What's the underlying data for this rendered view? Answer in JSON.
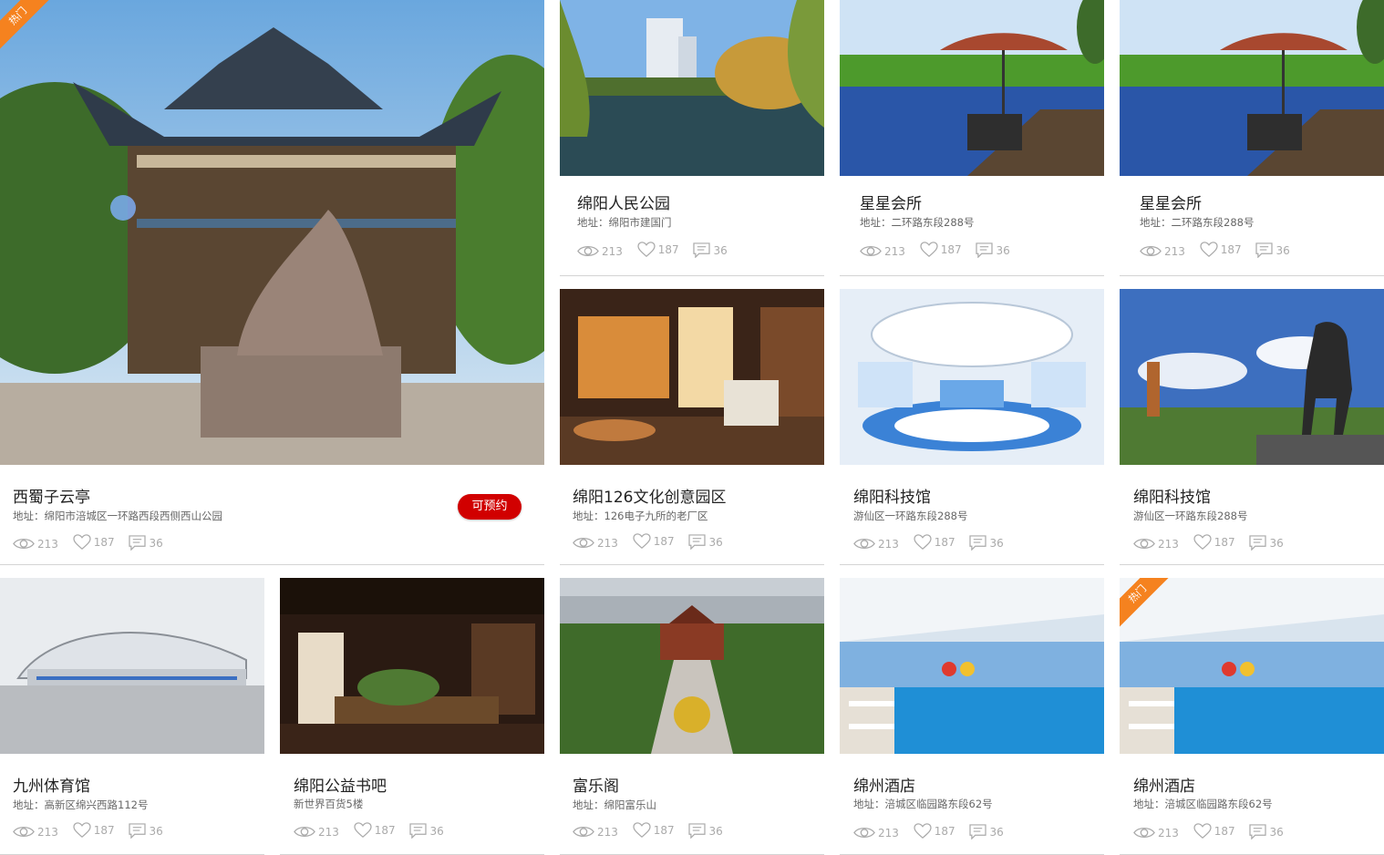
{
  "badges": {
    "hot": "热门",
    "reserve": "可预约"
  },
  "cards": [
    {
      "title": "西蜀子云亭",
      "address": "地址：绵阳市涪城区一环路西段西侧西山公园",
      "views": "213",
      "likes": "187",
      "comments": "36",
      "image": "temple-statue"
    },
    {
      "title": "绵阳人民公园",
      "address": "地址：绵阳市建国门",
      "views": "213",
      "likes": "187",
      "comments": "36",
      "image": "lake-park"
    },
    {
      "title": "星星会所",
      "address": "地址：二环路东段288号",
      "views": "213",
      "likes": "187",
      "comments": "36",
      "image": "deck-umbrella"
    },
    {
      "title": "星星会所",
      "address": "地址：二环路东段288号",
      "views": "213",
      "likes": "187",
      "comments": "36",
      "image": "deck-umbrella"
    },
    {
      "title": "绵阳126文化创意园区",
      "address": "地址：126电子九所的老厂区",
      "views": "213",
      "likes": "187",
      "comments": "36",
      "image": "interior-lounge"
    },
    {
      "title": "绵阳科技馆",
      "address": "游仙区一环路东段288号",
      "views": "213",
      "likes": "187",
      "comments": "36",
      "image": "tech-hall"
    },
    {
      "title": "绵阳科技馆",
      "address": "游仙区一环路东段288号",
      "views": "213",
      "likes": "187",
      "comments": "36",
      "image": "horse-statue"
    },
    {
      "title": "九州体育馆",
      "address": "地址：高新区绵兴西路112号",
      "views": "213",
      "likes": "187",
      "comments": "36",
      "image": "stadium"
    },
    {
      "title": "绵阳公益书吧",
      "address": "新世界百货5楼",
      "views": "213",
      "likes": "187",
      "comments": "36",
      "image": "book-bar"
    },
    {
      "title": "富乐阁",
      "address": "地址：绵阳富乐山",
      "views": "213",
      "likes": "187",
      "comments": "36",
      "image": "aerial-temple"
    },
    {
      "title": "绵州酒店",
      "address": "地址：涪城区临园路东段62号",
      "views": "213",
      "likes": "187",
      "comments": "36",
      "image": "indoor-pool"
    },
    {
      "title": "绵州酒店",
      "address": "地址：涪城区临园路东段62号",
      "views": "213",
      "likes": "187",
      "comments": "36",
      "image": "indoor-pool"
    }
  ]
}
